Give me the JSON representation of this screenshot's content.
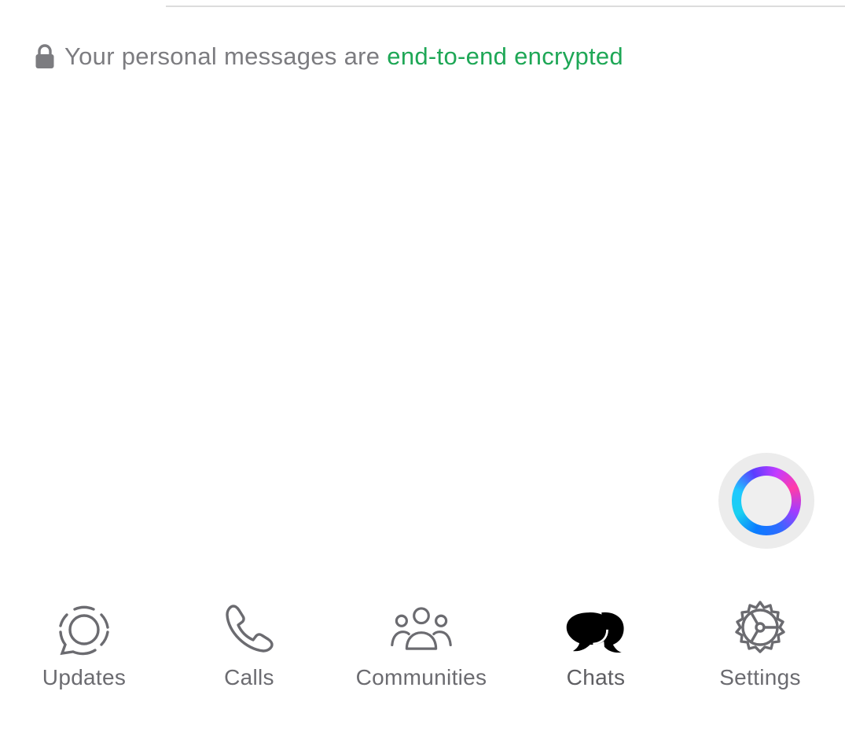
{
  "notice": {
    "text": "Your personal messages are",
    "link_text": "end-to-end encrypted",
    "icon": "lock-icon",
    "link_color": "#1ea756"
  },
  "floating_button": {
    "icon": "meta-ai-ring-icon"
  },
  "tab_bar": {
    "active": "Chats",
    "items": [
      {
        "label": "Updates",
        "icon": "updates-icon"
      },
      {
        "label": "Calls",
        "icon": "phone-icon"
      },
      {
        "label": "Communities",
        "icon": "communities-icon"
      },
      {
        "label": "Chats",
        "icon": "chats-icon"
      },
      {
        "label": "Settings",
        "icon": "gear-icon"
      }
    ]
  }
}
